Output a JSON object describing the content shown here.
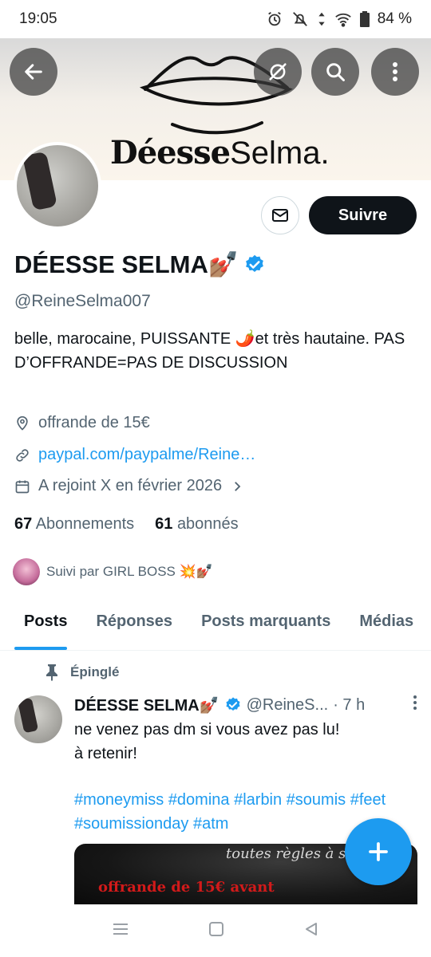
{
  "status_bar": {
    "time": "19:05",
    "battery": "84 %"
  },
  "banner": {
    "title_bold": "Déesse",
    "title_thin": "Selma."
  },
  "header_buttons": {
    "back": "back-arrow-icon",
    "sync": "sync-off-icon",
    "search": "search-icon",
    "more": "more-vertical-icon"
  },
  "profile": {
    "name": "DÉESSE SELMA💅🏽",
    "handle": "@ReineSelma007",
    "bio": "belle, marocaine, PUISSANTE 🌶️et très hautaine. PAS D’OFFRANDE=PAS DE DISCUSSION",
    "location": "offrande de 15€",
    "link": "paypal.com/paypalme/Reine…",
    "joined": "A rejoint X en février 2026",
    "following_count": "67",
    "following_label": "Abonnements",
    "followers_count": "61",
    "followers_label": "abonnés",
    "followed_by": "Suivi par GIRL BOSS 💥💅🏽"
  },
  "actions": {
    "follow_label": "Suivre"
  },
  "tabs": [
    {
      "label": "Posts"
    },
    {
      "label": "Réponses"
    },
    {
      "label": "Posts marquants"
    },
    {
      "label": "Médias"
    }
  ],
  "post": {
    "pinned_label": "Épinglé",
    "author_name": "DÉESSE SELMA💅🏽",
    "author_handle": "@ReineS...",
    "time": "· 7 h",
    "text": "ne venez pas dm si vous avez pas lu!\nà retenir!",
    "hashtags": "#moneymiss #domina #larbin #soumis #feet #soumissionday #atm",
    "media_line1": "toutes règles à se",
    "media_line2": "offrande de 15€ avant"
  },
  "colors": {
    "accent": "#1d9bf0",
    "text": "#0f1419",
    "muted": "#536471",
    "follow_bg": "#0f1419"
  }
}
